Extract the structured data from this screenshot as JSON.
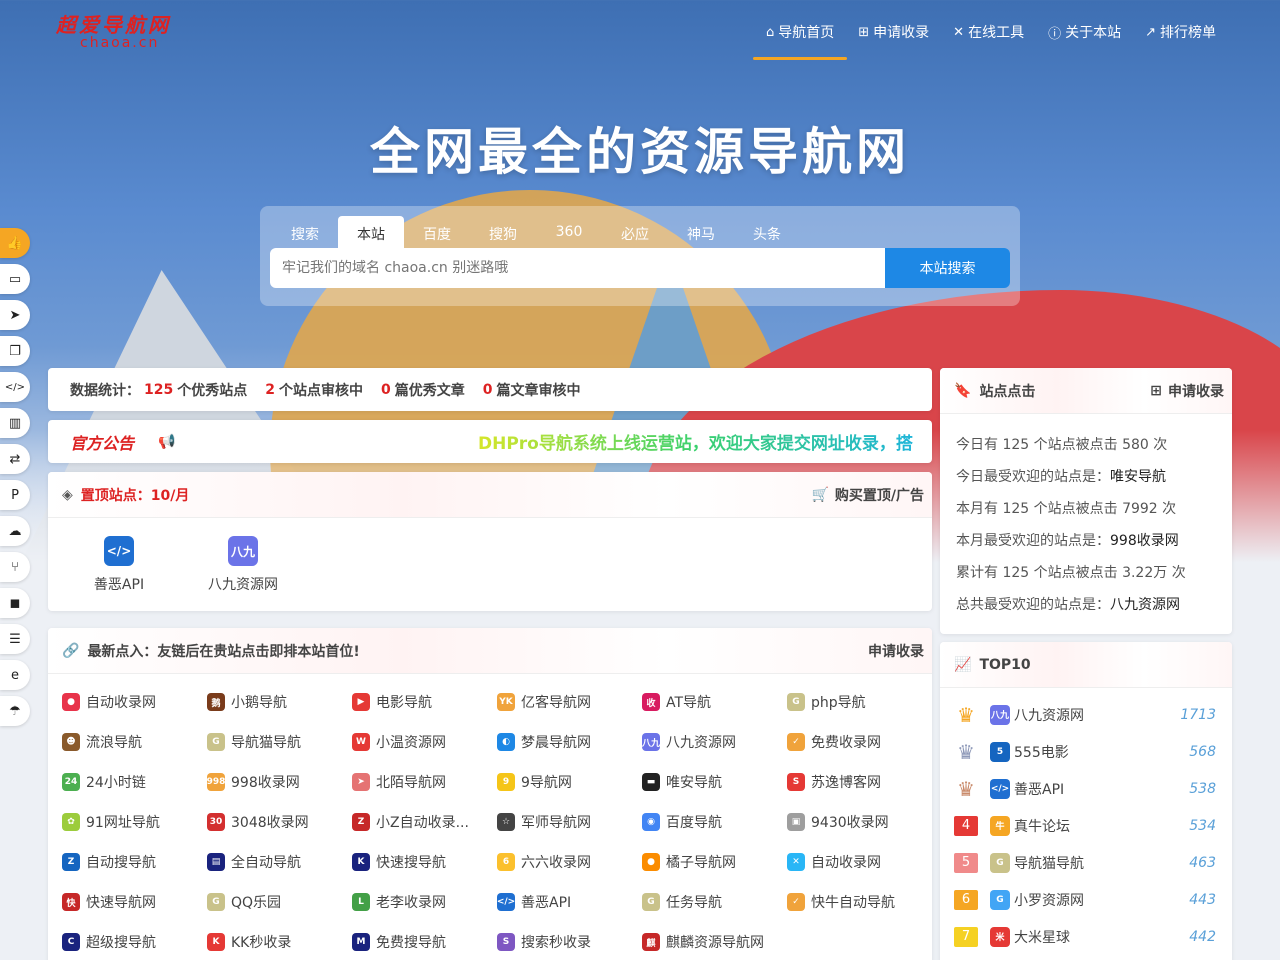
{
  "brand": {
    "title_cn": "超爱导航网",
    "domain": "chaoa.cn",
    "accent": "#d22222",
    "nav_underline": "#f5a623"
  },
  "nav": [
    {
      "label": "导航首页",
      "icon": "home-icon",
      "glyph": "⌂",
      "active": true
    },
    {
      "label": "申请收录",
      "icon": "plus-square-icon",
      "glyph": "⊞",
      "active": false
    },
    {
      "label": "在线工具",
      "icon": "tools-icon",
      "glyph": "✕",
      "active": false
    },
    {
      "label": "关于本站",
      "icon": "info-icon",
      "glyph": "ⓘ",
      "active": false
    },
    {
      "label": "排行榜单",
      "icon": "chart-line-icon",
      "glyph": "↗",
      "active": false
    }
  ],
  "hero": {
    "title": "全网最全的资源导航网"
  },
  "search": {
    "tabs": [
      "搜索",
      "本站",
      "百度",
      "搜狗",
      "360",
      "必应",
      "神马",
      "头条"
    ],
    "active_tab": 1,
    "placeholder": "牢记我们的域名 chaoa.cn 别迷路哦",
    "button": "本站搜索",
    "button_color": "#1e88e5"
  },
  "sidebar": [
    {
      "icon": "thumbs-up-icon",
      "glyph": "👍",
      "hot": true
    },
    {
      "icon": "laptop-icon",
      "glyph": "▭",
      "hot": false
    },
    {
      "icon": "paper-plane-icon",
      "glyph": "➤",
      "hot": false
    },
    {
      "icon": "window-icon",
      "glyph": "❐",
      "hot": false
    },
    {
      "icon": "code-icon",
      "glyph": "</>",
      "hot": false
    },
    {
      "icon": "book-icon",
      "glyph": "▥",
      "hot": false
    },
    {
      "icon": "exchange-icon",
      "glyph": "⇄",
      "hot": false
    },
    {
      "icon": "paypal-icon",
      "glyph": "P",
      "hot": false
    },
    {
      "icon": "cloud-download-icon",
      "glyph": "☁",
      "hot": false
    },
    {
      "icon": "usb-icon",
      "glyph": "⑂",
      "hot": false
    },
    {
      "icon": "shopping-bag-icon",
      "glyph": "◼",
      "hot": false
    },
    {
      "icon": "server-icon",
      "glyph": "☰",
      "hot": false
    },
    {
      "icon": "edge-icon",
      "glyph": "e",
      "hot": false
    },
    {
      "icon": "cloud-rain-icon",
      "glyph": "☂",
      "hot": false
    }
  ],
  "stats": {
    "label": "数据统计：",
    "items": [
      {
        "num": "125",
        "text": "个优秀站点"
      },
      {
        "num": "2",
        "text": "个站点审核中"
      },
      {
        "num": "0",
        "text": "篇优秀文章"
      },
      {
        "num": "0",
        "text": "篇文章审核中"
      }
    ]
  },
  "notice": {
    "title": "官方公告",
    "text": "DHPro导航系统上线运营站，欢迎大家提交网址收录，搭"
  },
  "top_sites": {
    "title": "置顶站点：10/月",
    "action": "购买置顶/广告",
    "items": [
      {
        "name": "善恶API",
        "color": "#1f6fd1",
        "glyph": "</>"
      },
      {
        "name": "八九资源网",
        "color": "#6b73e8",
        "glyph": "八九"
      }
    ]
  },
  "latest": {
    "title": "最新点入：友链后在贵站点击即排本站首位!",
    "action": "申请收录",
    "items": [
      {
        "name": "自动收录网",
        "color": "#e8334a",
        "glyph": "●"
      },
      {
        "name": "小鹅导航",
        "color": "#7a3b1b",
        "glyph": "鹅"
      },
      {
        "name": "电影导航",
        "color": "#e53935",
        "glyph": "▶"
      },
      {
        "name": "亿客导航网",
        "color": "#f0a33b",
        "glyph": "YK"
      },
      {
        "name": "AT导航",
        "color": "#d81b60",
        "glyph": "收"
      },
      {
        "name": "php导航",
        "color": "#c9c28a",
        "glyph": "G"
      },
      {
        "name": "流浪导航",
        "color": "#8a5a2b",
        "glyph": "☻"
      },
      {
        "name": "导航猫导航",
        "color": "#c9c28a",
        "glyph": "G"
      },
      {
        "name": "小温资源网",
        "color": "#e53935",
        "glyph": "W"
      },
      {
        "name": "梦晨导航网",
        "color": "#1e88e5",
        "glyph": "◐"
      },
      {
        "name": "八九资源网",
        "color": "#6b73e8",
        "glyph": "八九"
      },
      {
        "name": "免费收录网",
        "color": "#f0a33b",
        "glyph": "✓"
      },
      {
        "name": "24小时链",
        "color": "#4caf50",
        "glyph": "24"
      },
      {
        "name": "998收录网",
        "color": "#f0a33b",
        "glyph": "998"
      },
      {
        "name": "北陌导航网",
        "color": "#e57373",
        "glyph": "➤"
      },
      {
        "name": "9导航网",
        "color": "#f5c518",
        "glyph": "9"
      },
      {
        "name": "唯安导航",
        "color": "#222222",
        "glyph": "▬"
      },
      {
        "name": "苏逸博客网",
        "color": "#e53935",
        "glyph": "S"
      },
      {
        "name": "91网址导航",
        "color": "#9ccc3c",
        "glyph": "✿"
      },
      {
        "name": "3048收录网",
        "color": "#d32f2f",
        "glyph": "30"
      },
      {
        "name": "小Z自动收录...",
        "color": "#c62828",
        "glyph": "Z"
      },
      {
        "name": "军师导航网",
        "color": "#444444",
        "glyph": "☆"
      },
      {
        "name": "百度导航",
        "color": "#4285f4",
        "glyph": "◉"
      },
      {
        "name": "9430收录网",
        "color": "#9e9e9e",
        "glyph": "▣"
      },
      {
        "name": "自动搜导航",
        "color": "#1565c0",
        "glyph": "Z"
      },
      {
        "name": "全自动导航",
        "color": "#1a237e",
        "glyph": "▤"
      },
      {
        "name": "快速搜导航",
        "color": "#1a237e",
        "glyph": "K"
      },
      {
        "name": "六六收录网",
        "color": "#fbc02d",
        "glyph": "6"
      },
      {
        "name": "橘子导航网",
        "color": "#fb8c00",
        "glyph": "●"
      },
      {
        "name": "自动收录网",
        "color": "#29b6f6",
        "glyph": "✕"
      },
      {
        "name": "快速导航网",
        "color": "#c62828",
        "glyph": "快"
      },
      {
        "name": "QQ乐园",
        "color": "#c9c28a",
        "glyph": "G"
      },
      {
        "name": "老李收录网",
        "color": "#43a047",
        "glyph": "L"
      },
      {
        "name": "善恶API",
        "color": "#1f6fd1",
        "glyph": "</>"
      },
      {
        "name": "任务导航",
        "color": "#c9c28a",
        "glyph": "G"
      },
      {
        "name": "快牛自动导航",
        "color": "#f0a33b",
        "glyph": "✓"
      },
      {
        "name": "超级搜导航",
        "color": "#1a237e",
        "glyph": "C"
      },
      {
        "name": "KK秒收录",
        "color": "#e53935",
        "glyph": "K"
      },
      {
        "name": "免费搜导航",
        "color": "#1a237e",
        "glyph": "M"
      },
      {
        "name": "搜索秒收录",
        "color": "#7e57c2",
        "glyph": "S"
      },
      {
        "name": "麒麟资源导航网",
        "color": "#c62828",
        "glyph": "麒"
      }
    ]
  },
  "clicks": {
    "title": "站点点击",
    "action": "申请收录",
    "rows": [
      {
        "text": "今日有 125 个站点被点击 580 次",
        "strong": ""
      },
      {
        "text": "今日最受欢迎的站点是：",
        "strong": "唯安导航"
      },
      {
        "text": "本月有 125 个站点被点击 7992 次",
        "strong": ""
      },
      {
        "text": "本月最受欢迎的站点是：",
        "strong": "998收录网"
      },
      {
        "text": "累计有 125 个站点被点击 3.22万 次",
        "strong": ""
      },
      {
        "text": "总共最受欢迎的站点是：",
        "strong": "八九资源网"
      }
    ]
  },
  "top10": {
    "title": "TOP10",
    "rows": [
      {
        "rank": "1",
        "crown": true,
        "rank_color": "#f5a623",
        "name": "八九资源网",
        "color": "#6b73e8",
        "glyph": "八九",
        "count": "1713"
      },
      {
        "rank": "2",
        "crown": true,
        "rank_color": "#8e99b8",
        "name": "555电影",
        "color": "#1565c0",
        "glyph": "5",
        "count": "568"
      },
      {
        "rank": "3",
        "crown": true,
        "rank_color": "#c98a6a",
        "name": "善恶API",
        "color": "#1f6fd1",
        "glyph": "</>",
        "count": "538"
      },
      {
        "rank": "4",
        "crown": false,
        "rank_color": "#e53935",
        "name": "真牛论坛",
        "color": "#f5a623",
        "glyph": "牛",
        "count": "534"
      },
      {
        "rank": "5",
        "crown": false,
        "rank_color": "#f08a8a",
        "name": "导航猫导航",
        "color": "#c9c28a",
        "glyph": "G",
        "count": "463"
      },
      {
        "rank": "6",
        "crown": false,
        "rank_color": "#f5a623",
        "name": "小罗资源网",
        "color": "#42a5f5",
        "glyph": "G",
        "count": "443"
      },
      {
        "rank": "7",
        "crown": false,
        "rank_color": "#f5d123",
        "name": "大米星球",
        "color": "#e53935",
        "glyph": "米",
        "count": "442"
      }
    ]
  }
}
